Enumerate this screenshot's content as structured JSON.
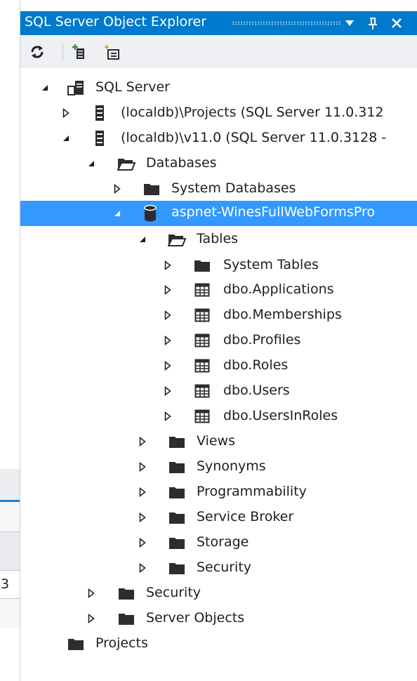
{
  "pane": {
    "title": "SQL Server Object Explorer",
    "toolbar": {
      "refresh_icon": "refresh-icon",
      "add_server_icon": "add-sql-server-icon",
      "new_query_icon": "new-query-icon"
    },
    "caption_buttons": {
      "dropdown_icon": "dropdown-icon",
      "pin_icon": "pin-icon",
      "close_icon": "close-icon"
    }
  },
  "tree": {
    "sql_server": "SQL Server",
    "projects_instance": "(localdb)\\Projects (SQL Server 11.0.312",
    "v11_instance": "(localdb)\\v11.0 (SQL Server 11.0.3128 -",
    "databases": "Databases",
    "system_databases": "System Databases",
    "aspnet_db": "aspnet-WinesFullWebFormsPro",
    "tables": "Tables",
    "system_tables": "System Tables",
    "tables_list": [
      "dbo.Applications",
      "dbo.Memberships",
      "dbo.Profiles",
      "dbo.Roles",
      "dbo.Users",
      "dbo.UsersInRoles"
    ],
    "views": "Views",
    "synonyms": "Synonyms",
    "programmability": "Programmability",
    "service_broker": "Service Broker",
    "storage": "Storage",
    "db_security": "Security",
    "server_security": "Security",
    "server_objects": "Server Objects",
    "projects": "Projects"
  },
  "background_window": {
    "cell_text": "3"
  },
  "colors": {
    "title_bar": "#007acc",
    "selection": "#3399ff",
    "toolbar": "#eef0f3"
  }
}
